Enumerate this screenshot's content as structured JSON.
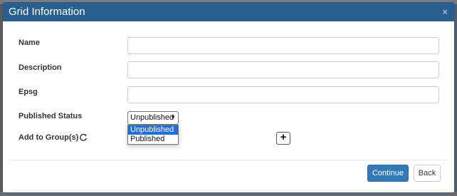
{
  "modal": {
    "title": "Grid Information",
    "close_icon": "×"
  },
  "fields": {
    "name": {
      "label": "Name",
      "value": "",
      "placeholder": ""
    },
    "description": {
      "label": "Description",
      "value": "",
      "placeholder": ""
    },
    "epsg": {
      "label": "Epsg",
      "value": "",
      "placeholder": ""
    },
    "published_status": {
      "label": "Published Status",
      "selected": "Unpublished",
      "options": [
        "Unpublished",
        "Published"
      ],
      "highlighted_option": "Unpublished"
    },
    "groups": {
      "label": "Add to Group(s)",
      "refresh_icon": "refresh-icon",
      "add_symbol": "+"
    }
  },
  "footer": {
    "continue_label": "Continue",
    "back_label": "Back"
  },
  "colors": {
    "header": "#285f8f",
    "primary_button": "#3379b7",
    "option_highlight": "#1e6fd9"
  }
}
